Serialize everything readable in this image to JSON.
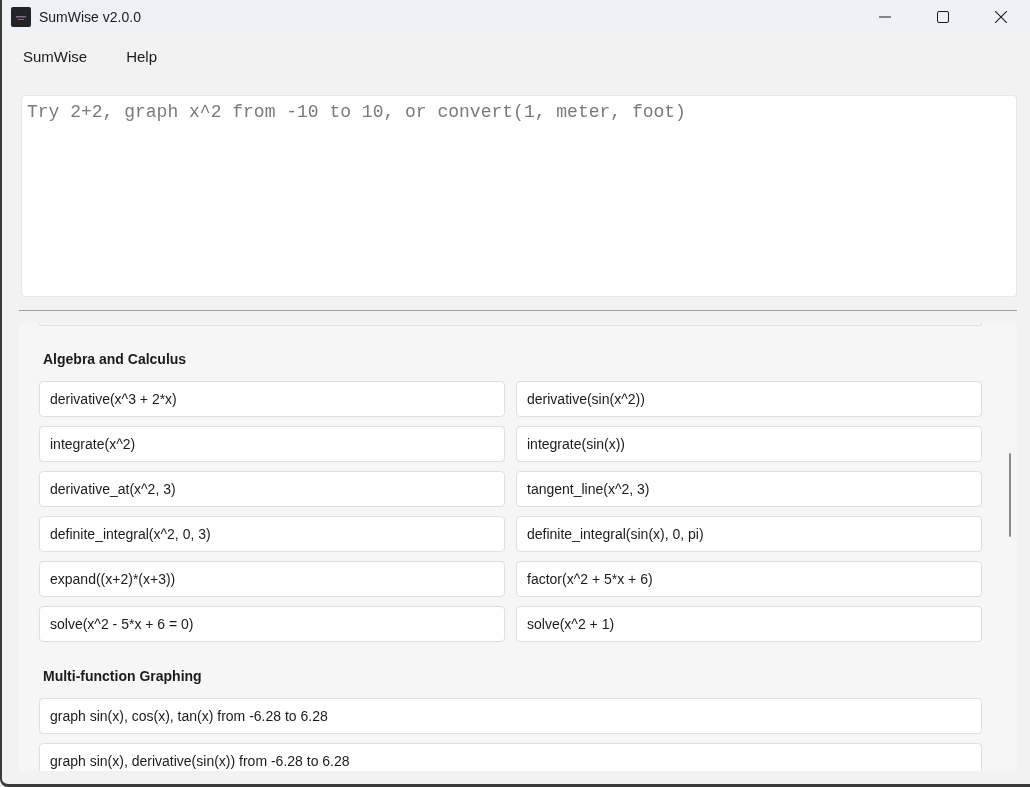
{
  "window": {
    "title": "SumWise v2.0.0"
  },
  "menu": [
    "SumWise",
    "Help"
  ],
  "input": {
    "placeholder": "Try 2+2, graph x^2 from -10 to 10, or convert(1, meter, foot)"
  },
  "sections": [
    {
      "title": "Algebra and Calculus",
      "kind": "grid",
      "examples": [
        "derivative(x^3 + 2*x)",
        "derivative(sin(x^2))",
        "integrate(x^2)",
        "integrate(sin(x))",
        "derivative_at(x^2, 3)",
        "tangent_line(x^2, 3)",
        "definite_integral(x^2, 0, 3)",
        "definite_integral(sin(x), 0, pi)",
        "expand((x+2)*(x+3))",
        "factor(x^2 + 5*x + 6)",
        "solve(x^2 - 5*x + 6 = 0)",
        "solve(x^2 + 1)"
      ]
    },
    {
      "title": "Multi-function Graphing",
      "kind": "list",
      "examples": [
        "graph sin(x), cos(x), tan(x) from -6.28 to 6.28",
        "graph sin(x), derivative(sin(x)) from -6.28 to 6.28"
      ]
    }
  ]
}
